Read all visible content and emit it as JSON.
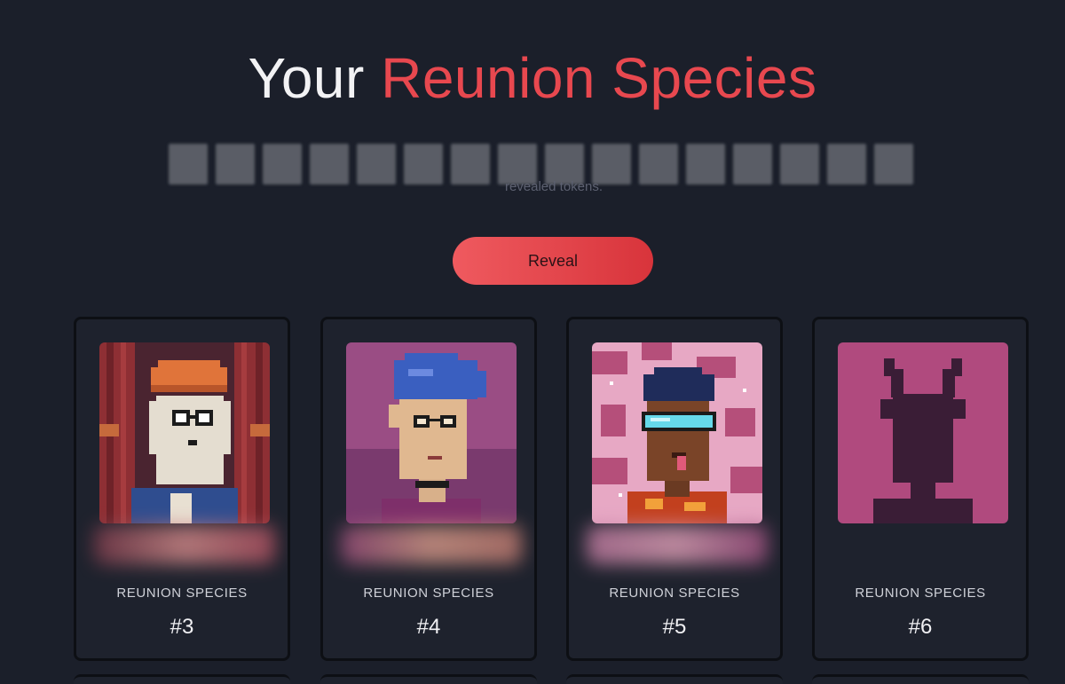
{
  "header": {
    "title_plain": "Your",
    "title_accent": "Reunion Species"
  },
  "subtitle": {
    "visible_line_2": "revealed tokens."
  },
  "actions": {
    "reveal_label": "Reveal"
  },
  "cards": [
    {
      "label": "REUNION SPECIES",
      "number": "#3",
      "image": "pixel-cat-with-glasses-and-beanie",
      "revealed": true
    },
    {
      "label": "REUNION SPECIES",
      "number": "#4",
      "image": "pixel-person-with-blue-hair",
      "revealed": true
    },
    {
      "label": "REUNION SPECIES",
      "number": "#5",
      "image": "pixel-person-with-visor-goggles",
      "revealed": true
    },
    {
      "label": "REUNION SPECIES",
      "number": "#6",
      "image": "unrevealed-horned-silhouette",
      "revealed": false
    }
  ],
  "colors": {
    "background": "#1b1f2a",
    "accent": "#e8484f",
    "card_background": "#1e222d",
    "unrevealed_tile": "#b04a7e"
  }
}
